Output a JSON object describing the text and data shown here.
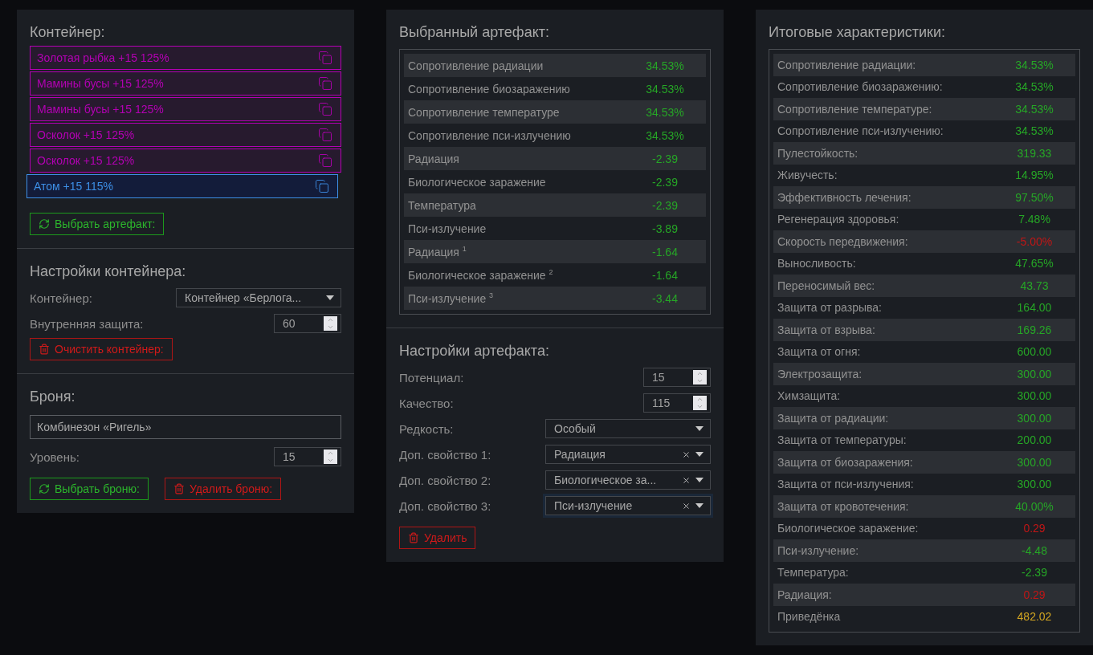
{
  "container_panel": {
    "title": "Контейнер:",
    "artifacts": [
      {
        "label": "Золотая рыбка +15 125%",
        "color": "#b400b4",
        "selected": false
      },
      {
        "label": "Мамины бусы +15 125%",
        "color": "#b400b4",
        "selected": false
      },
      {
        "label": "Мамины бусы +15 125%",
        "color": "#b400b4",
        "selected": false
      },
      {
        "label": "Осколок +15 125%",
        "color": "#b400b4",
        "selected": false
      },
      {
        "label": "Осколок +15 125%",
        "color": "#b400b4",
        "selected": false
      },
      {
        "label": "Атом +15 115%",
        "color": "#3d8fe6",
        "selected": true
      }
    ],
    "select_button": "Выбрать артефакт:",
    "settings_title": "Настройки контейнера:",
    "fields": [
      {
        "kind": "select",
        "label": "Контейнер:",
        "value": "Контейнер «Берлога..."
      },
      {
        "kind": "number",
        "label": "Внутренняя защита:",
        "value": "60"
      }
    ],
    "clear_button": "Очистить контейнер:",
    "armor_title": "Броня:",
    "armor_name": "Комбинезон «Ригель»",
    "armor_fields": [
      {
        "kind": "number",
        "label": "Уровень:",
        "value": "15"
      }
    ],
    "armor_buttons": [
      {
        "kind": "select",
        "label": "Выбрать броню:"
      },
      {
        "kind": "delete",
        "label": "Удалить броню:"
      }
    ]
  },
  "artifact_panel": {
    "title": "Выбранный артефакт:",
    "stats": [
      {
        "label": "Сопротивление радиации",
        "value": "34.53%",
        "color": "#26a626"
      },
      {
        "label": "Сопротивление биозаражению",
        "value": "34.53%",
        "color": "#26a626"
      },
      {
        "label": "Сопротивление температуре",
        "value": "34.53%",
        "color": "#26a626"
      },
      {
        "label": "Сопротивление пси-излучению",
        "value": "34.53%",
        "color": "#26a626"
      },
      {
        "label": "Радиация",
        "value": "-2.39",
        "color": "#26a626"
      },
      {
        "label": "Биологическое заражение",
        "value": "-2.39",
        "color": "#26a626"
      },
      {
        "label": "Температура",
        "value": "-2.39",
        "color": "#26a626"
      },
      {
        "label": "Пси-излучение",
        "value": "-3.89",
        "color": "#26a626"
      },
      {
        "label": "Радиация $^{1}$",
        "value": "-1.64",
        "color": "#26a626"
      },
      {
        "label": "Биологическое заражение $^{2}$",
        "value": "-1.64",
        "color": "#26a626"
      },
      {
        "label": "Пси-излучение $^{3}$",
        "value": "-3.44",
        "color": "#26a626"
      }
    ],
    "settings_title": "Настройки артефакта:",
    "fields": [
      {
        "kind": "number",
        "label": "Потенциал:",
        "value": "15"
      },
      {
        "kind": "number",
        "label": "Качество:",
        "value": "115"
      },
      {
        "kind": "select",
        "label": "Редкость:",
        "value": "Особый",
        "clearable": false,
        "focused": false
      },
      {
        "kind": "select",
        "label": "Доп. свойство 1:",
        "value": "Радиация",
        "clearable": true,
        "focused": false
      },
      {
        "kind": "select",
        "label": "Доп. свойство 2:",
        "value": "Биологическое за...",
        "clearable": true,
        "focused": false
      },
      {
        "kind": "select",
        "label": "Доп. свойство 3:",
        "value": "Пси-излучение",
        "clearable": true,
        "focused": true
      }
    ],
    "delete_button": "Удалить"
  },
  "totals_panel": {
    "title": "Итоговые характеристики:",
    "stats": [
      {
        "label": "Сопротивление радиации:",
        "value": "34.53%",
        "color": "#26a626"
      },
      {
        "label": "Сопротивление биозаражению:",
        "value": "34.53%",
        "color": "#26a626"
      },
      {
        "label": "Сопротивление температуре:",
        "value": "34.53%",
        "color": "#26a626"
      },
      {
        "label": "Сопротивление пси-излучению:",
        "value": "34.53%",
        "color": "#26a626"
      },
      {
        "label": "Пулестойкость:",
        "value": "319.33",
        "color": "#26a626"
      },
      {
        "label": "Живучесть:",
        "value": "14.95%",
        "color": "#26a626"
      },
      {
        "label": "Эффективность лечения:",
        "value": "97.50%",
        "color": "#26a626"
      },
      {
        "label": "Регенерация здоровья:",
        "value": "7.48%",
        "color": "#26a626"
      },
      {
        "label": "Скорость передвижения:",
        "value": "-5.00%",
        "color": "#c01616"
      },
      {
        "label": "Выносливость:",
        "value": "47.65%",
        "color": "#26a626"
      },
      {
        "label": "Переносимый вес:",
        "value": "43.73",
        "color": "#26a626"
      },
      {
        "label": "Защита от разрыва:",
        "value": "164.00",
        "color": "#26a626"
      },
      {
        "label": "Защита от взрыва:",
        "value": "169.26",
        "color": "#26a626"
      },
      {
        "label": "Защита от огня:",
        "value": "600.00",
        "color": "#26a626"
      },
      {
        "label": "Электрозащита:",
        "value": "300.00",
        "color": "#26a626"
      },
      {
        "label": "Химзащита:",
        "value": "300.00",
        "color": "#26a626"
      },
      {
        "label": "Защита от радиации:",
        "value": "300.00",
        "color": "#26a626"
      },
      {
        "label": "Защита от температуры:",
        "value": "200.00",
        "color": "#26a626"
      },
      {
        "label": "Защита от биозаражения:",
        "value": "300.00",
        "color": "#26a626"
      },
      {
        "label": "Защита от пси-излучения:",
        "value": "300.00",
        "color": "#26a626"
      },
      {
        "label": "Защита от кровотечения:",
        "value": "40.00%",
        "color": "#26a626"
      },
      {
        "label": "Биологическое заражение:",
        "value": "0.29",
        "color": "#c01616"
      },
      {
        "label": "Пси-излучение:",
        "value": "-4.48",
        "color": "#26a626"
      },
      {
        "label": "Температура:",
        "value": "-2.39",
        "color": "#26a626"
      },
      {
        "label": "Радиация:",
        "value": "0.29",
        "color": "#c01616"
      },
      {
        "label": "Приведёнка",
        "value": "482.02",
        "color": "#d2a521"
      }
    ]
  }
}
